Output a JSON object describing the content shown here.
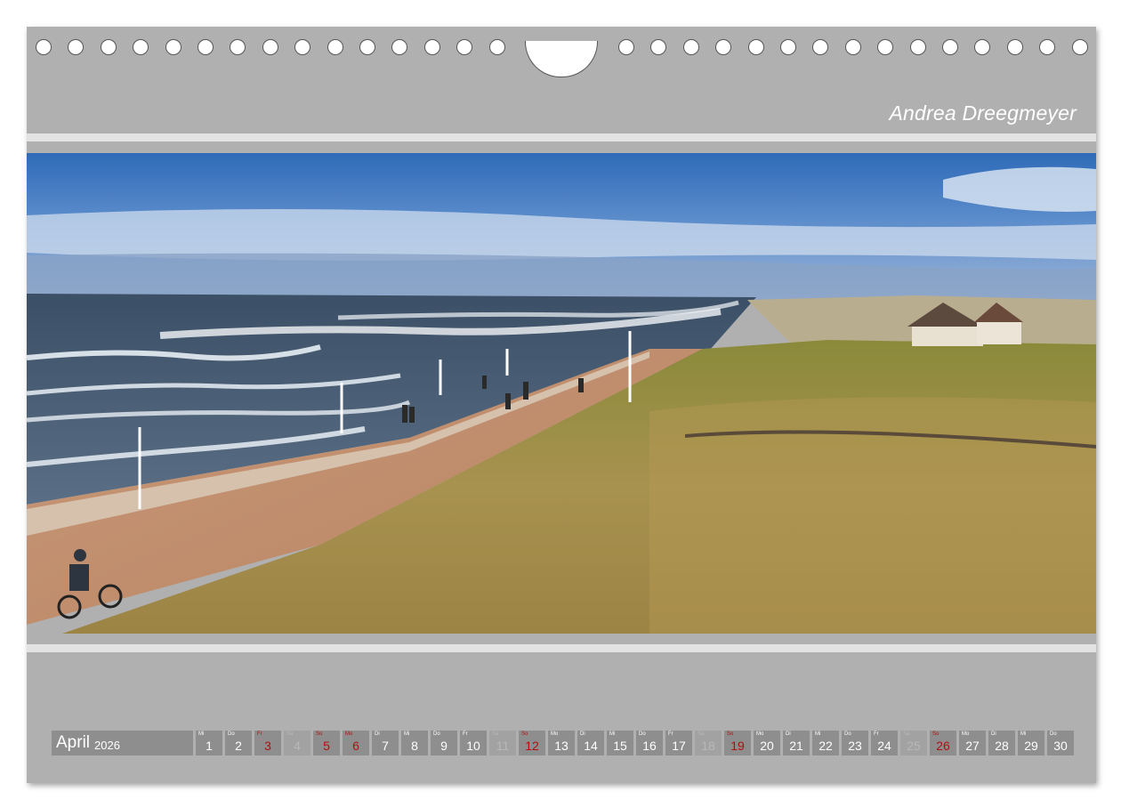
{
  "header": {
    "author": "Andrea Dreegmeyer"
  },
  "calendar": {
    "month": "April",
    "year": "2026",
    "days": [
      {
        "wd": "Mi",
        "d": "1",
        "type": "normal"
      },
      {
        "wd": "Do",
        "d": "2",
        "type": "normal"
      },
      {
        "wd": "Fr",
        "d": "3",
        "type": "holiday"
      },
      {
        "wd": "Sa",
        "d": "4",
        "type": "dim"
      },
      {
        "wd": "So",
        "d": "5",
        "type": "holiday"
      },
      {
        "wd": "Mo",
        "d": "6",
        "type": "holiday"
      },
      {
        "wd": "Di",
        "d": "7",
        "type": "normal"
      },
      {
        "wd": "Mi",
        "d": "8",
        "type": "normal"
      },
      {
        "wd": "Do",
        "d": "9",
        "type": "normal"
      },
      {
        "wd": "Fr",
        "d": "10",
        "type": "normal"
      },
      {
        "wd": "Sa",
        "d": "11",
        "type": "dim"
      },
      {
        "wd": "So",
        "d": "12",
        "type": "sun"
      },
      {
        "wd": "Mo",
        "d": "13",
        "type": "normal"
      },
      {
        "wd": "Di",
        "d": "14",
        "type": "normal"
      },
      {
        "wd": "Mi",
        "d": "15",
        "type": "normal"
      },
      {
        "wd": "Do",
        "d": "16",
        "type": "normal"
      },
      {
        "wd": "Fr",
        "d": "17",
        "type": "normal"
      },
      {
        "wd": "Sa",
        "d": "18",
        "type": "dim"
      },
      {
        "wd": "So",
        "d": "19",
        "type": "sun"
      },
      {
        "wd": "Mo",
        "d": "20",
        "type": "normal"
      },
      {
        "wd": "Di",
        "d": "21",
        "type": "normal"
      },
      {
        "wd": "Mi",
        "d": "22",
        "type": "normal"
      },
      {
        "wd": "Do",
        "d": "23",
        "type": "normal"
      },
      {
        "wd": "Fr",
        "d": "24",
        "type": "normal"
      },
      {
        "wd": "Sa",
        "d": "25",
        "type": "dim"
      },
      {
        "wd": "So",
        "d": "26",
        "type": "sun"
      },
      {
        "wd": "Mo",
        "d": "27",
        "type": "normal"
      },
      {
        "wd": "Di",
        "d": "28",
        "type": "normal"
      },
      {
        "wd": "Mi",
        "d": "29",
        "type": "normal"
      },
      {
        "wd": "Do",
        "d": "30",
        "type": "normal"
      }
    ]
  },
  "colors": {
    "page": "#b0b0b0",
    "day_box": "#8e8e8e",
    "holiday_text": "#b01010"
  }
}
